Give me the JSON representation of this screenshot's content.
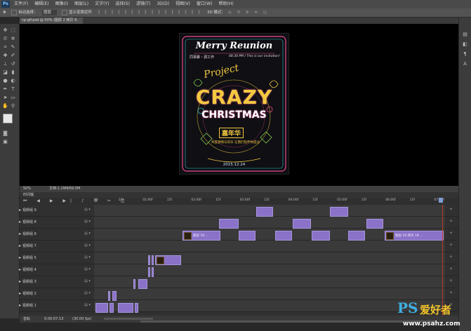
{
  "menubar": {
    "logo": "Ps",
    "menus": [
      "文件(F)",
      "编辑(E)",
      "图像(I)",
      "图层(L)",
      "文字(Y)",
      "选择(S)",
      "滤镜(T)",
      "3D(D)",
      "视图(V)",
      "窗口(W)",
      "帮助(H)"
    ]
  },
  "options": {
    "auto_select": "自动选择：",
    "layer_dropdown": "图层",
    "show_transform": "显示变换控件",
    "mode_3d": "3D 模式："
  },
  "document_tab": "cp-gif.psd @ 50% (图层 2 拷贝 4, RGB/8)",
  "poster": {
    "line1": "Merry Reunion",
    "line2": "同事聚・调工作",
    "line3": "08:30 PM / This is our invitation!",
    "word_project": "Project",
    "word_crazy": "CRAZY",
    "word_christmas": "CHRISTMAS",
    "badge": "嘉年华",
    "small_cn": "共度激情与欢乐 让我们陪伴你度过",
    "date": "2015.12.24"
  },
  "status": {
    "zoom": "50%",
    "doc": "文档:1.29M/69.5M"
  },
  "timeline": {
    "title": "时间轴",
    "ruler_ticks": [
      "00",
      "15f",
      "01:00f",
      "15f",
      "02:00f",
      "15f",
      "03:00f",
      "15f",
      "04:00f",
      "15f",
      "05:00f",
      "15f",
      "06:00f",
      "15f",
      "07:00f"
    ],
    "tracks": [
      {
        "label": "视频组 9"
      },
      {
        "label": "视频组 8"
      },
      {
        "label": "视频组 6"
      },
      {
        "label": "视频组 7"
      },
      {
        "label": "视频组 5"
      },
      {
        "label": "视频组 4"
      },
      {
        "label": "视频组 3"
      },
      {
        "label": "视频组 2"
      },
      {
        "label": "视频组 1"
      }
    ],
    "clip_labels": {
      "c6a": "图层 18 ...",
      "c6b": "图层 18 拷贝 18 ..."
    },
    "footer": {
      "audio": "音轨",
      "time": "0:00:07:13",
      "fps": "(30.00 fps)"
    }
  },
  "watermark": {
    "logo": "PS",
    "cn": "爱好者",
    "url": "www.psahz.com"
  },
  "colors": {
    "clip": "#8a72c8",
    "playhead": "#c0392b",
    "canvas": "#000000"
  }
}
